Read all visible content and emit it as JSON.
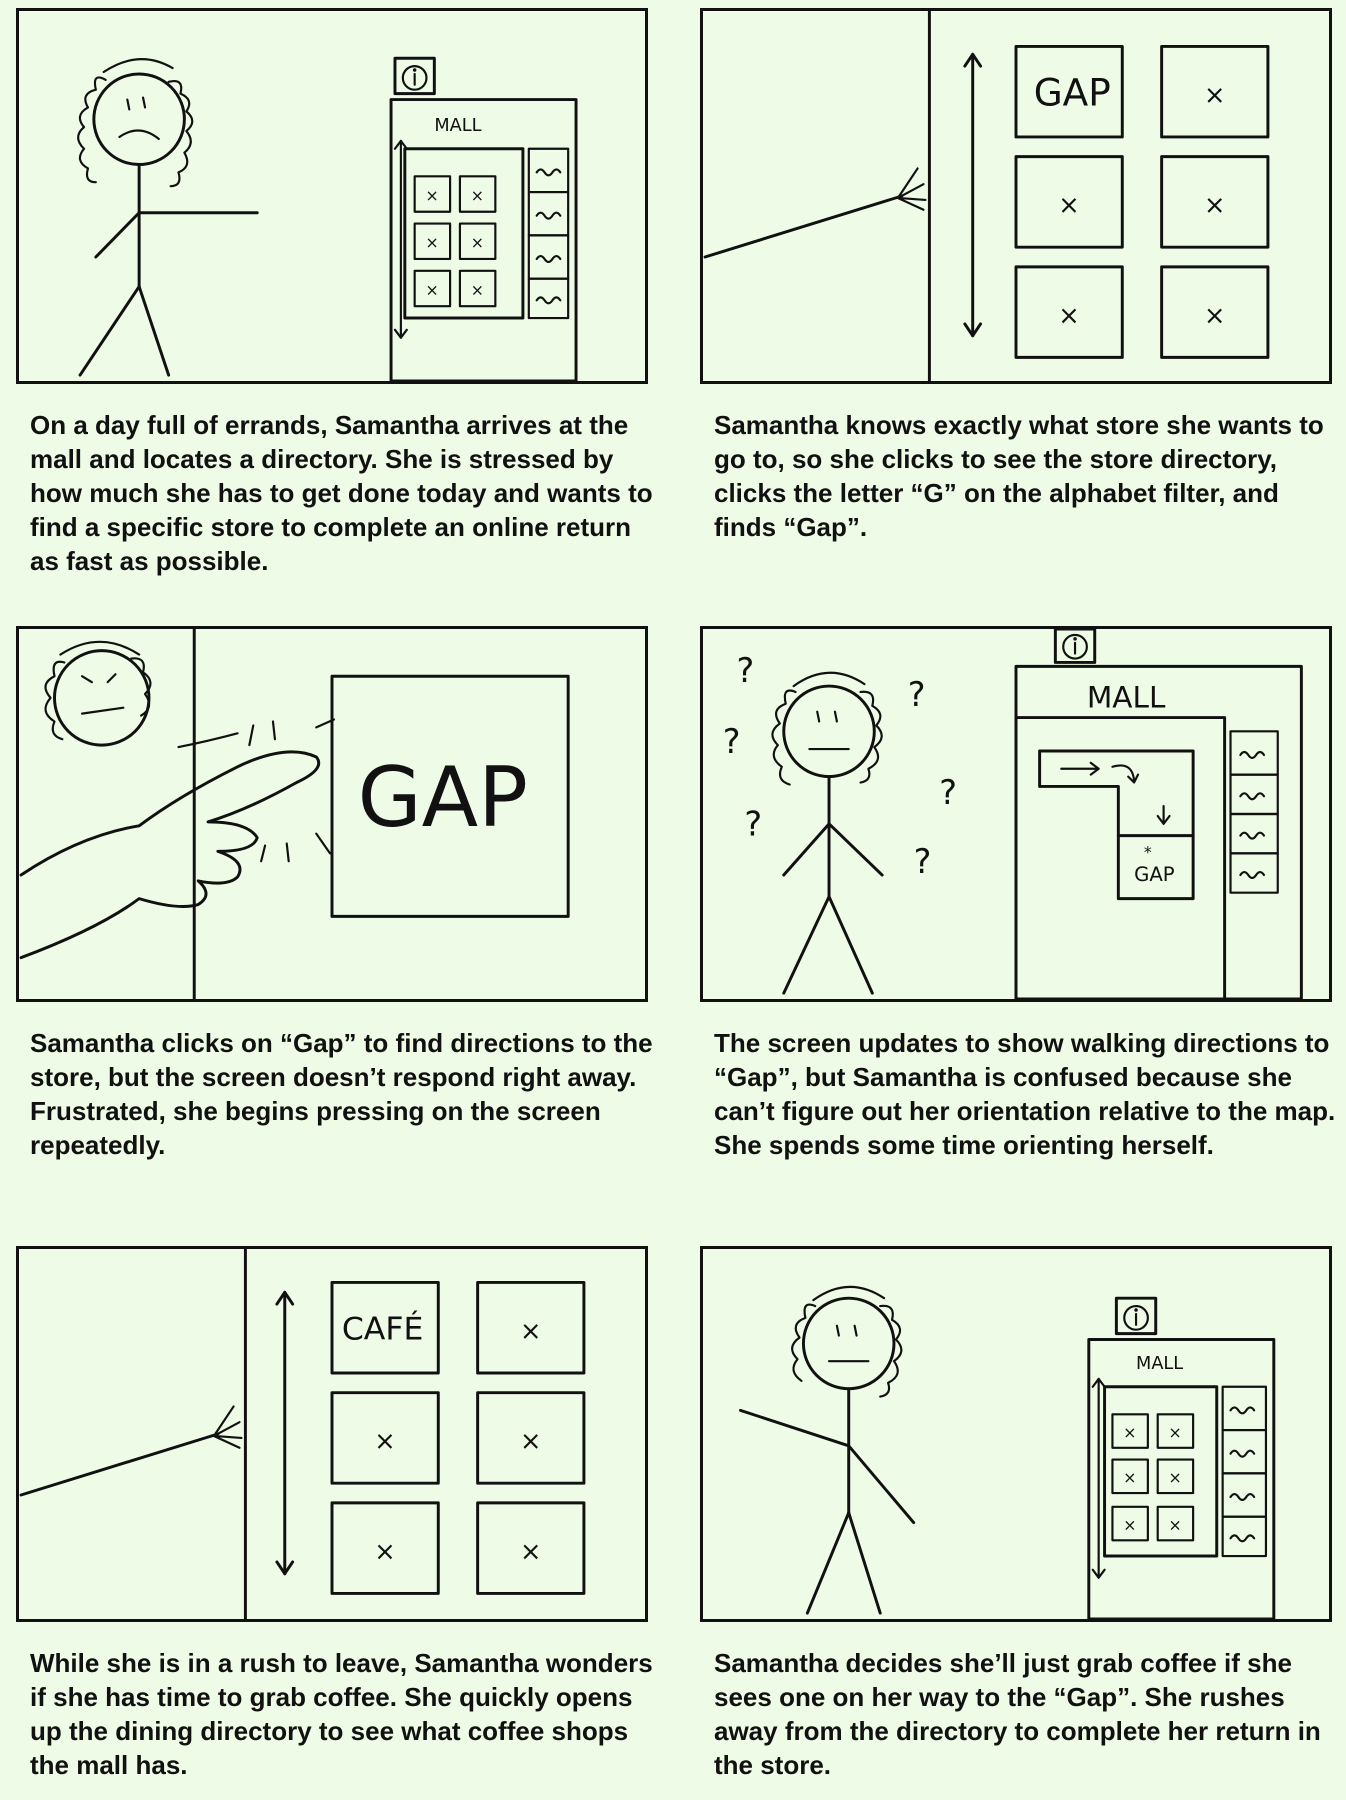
{
  "panels": [
    {
      "caption": "On a day full of errands, Samantha arrives at the mall and locates a directory. She is stressed by how much she has to get done today and wants to find a specific store to complete an online return as fast as possible.",
      "sketch_text": [
        "MALL"
      ]
    },
    {
      "caption": "Samantha knows exactly what store she wants to go to, so she clicks to see the store directory, clicks the letter “G” on the alphabet filter, and finds “Gap”.",
      "sketch_text": [
        "GAP"
      ]
    },
    {
      "caption": "Samantha clicks on “Gap” to find directions to the store, but the screen doesn’t respond right away. Frustrated, she begins pressing on the screen repeatedly.",
      "sketch_text": [
        "GAP"
      ]
    },
    {
      "caption": "The screen updates to show walking directions to “Gap”, but Samantha is confused because she can’t figure out her orientation relative to the map. She spends some time orienting herself.",
      "sketch_text": [
        "MALL",
        "GAP"
      ]
    },
    {
      "caption": "While she is in a rush to leave, Samantha wonders if she has time to grab coffee. She quickly opens up the dining directory to see what coffee shops the mall has.",
      "sketch_text": [
        "CAFÉ"
      ]
    },
    {
      "caption": "Samantha decides she’ll just grab coffee if she sees one on her way to the “Gap”. She rushes away from the directory to complete her return in the store.",
      "sketch_text": [
        "MALL"
      ]
    }
  ],
  "icons": [
    "info-icon",
    "x-mark-icon",
    "arrow-icon",
    "question-mark-icon"
  ],
  "colors": {
    "background": "#eefbe6",
    "ink": "#111111"
  }
}
